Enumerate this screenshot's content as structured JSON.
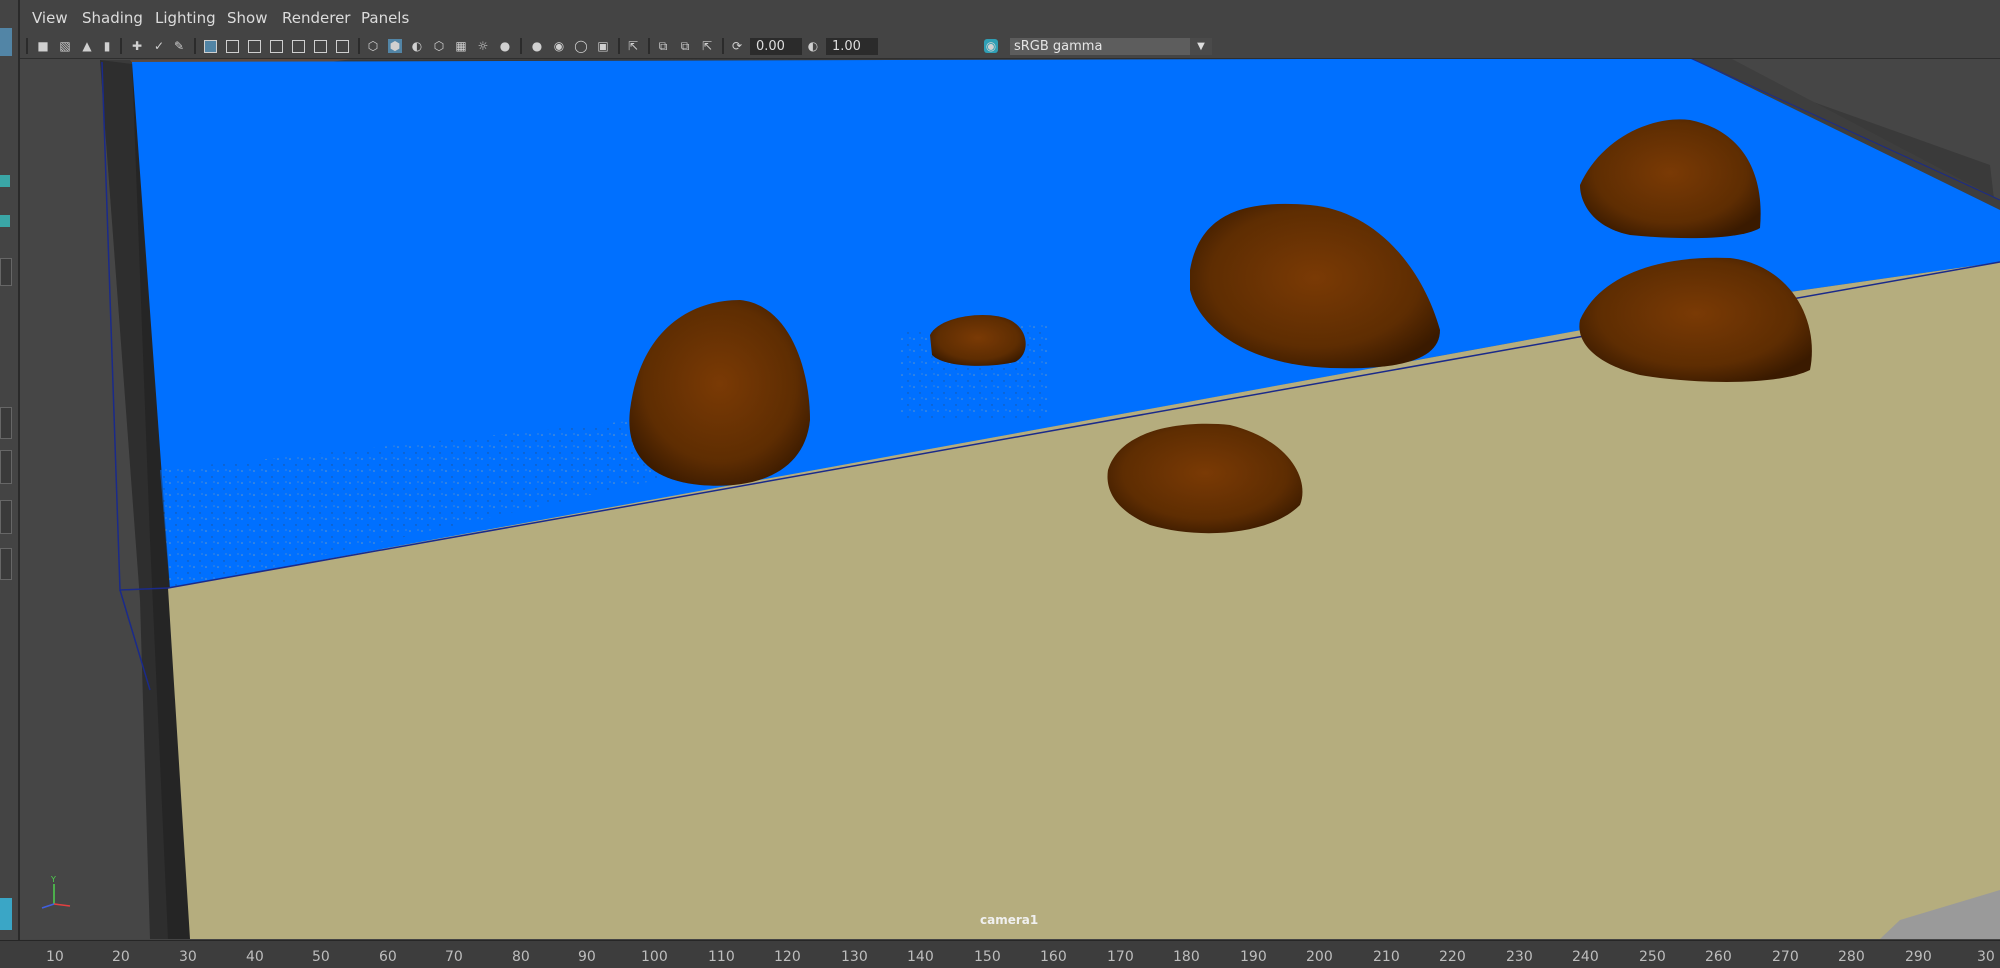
{
  "menu": [
    "View",
    "Shading",
    "Lighting",
    "Show",
    "Renderer",
    "Panels"
  ],
  "toolbar": {
    "exposure_value": "0.00",
    "gamma_value": "1.00",
    "color_space": "sRGB gamma"
  },
  "viewport": {
    "camera_label": "camera1",
    "axis_label": "Y"
  },
  "timeline": {
    "ticks": [
      "10",
      "20",
      "30",
      "40",
      "50",
      "60",
      "70",
      "80",
      "90",
      "100",
      "110",
      "120",
      "130",
      "140",
      "150",
      "160",
      "170",
      "180",
      "190",
      "200",
      "210",
      "220",
      "230",
      "240",
      "250",
      "260",
      "270",
      "280",
      "290",
      "30"
    ]
  },
  "colors": {
    "water": "#0070ff",
    "sand": "#b5ad7e",
    "rock": "#6b3100",
    "background": "#444444",
    "accent": "#5285a6"
  }
}
